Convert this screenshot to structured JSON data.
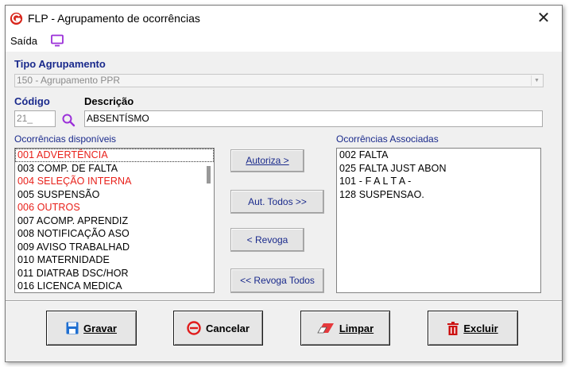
{
  "window": {
    "title": "FLP - Agrupamento de ocorrências",
    "close_symbol": "✕"
  },
  "menu": {
    "saida_label": "Saída"
  },
  "tipo": {
    "label": "Tipo Agrupamento",
    "value": "150 - Agrupamento PPR"
  },
  "codigo": {
    "label": "Código",
    "value": "21_"
  },
  "descricao": {
    "label": "Descrição",
    "value": "ABSENTÍSMO"
  },
  "available": {
    "label": "Ocorrências disponíveis",
    "items": [
      {
        "text": "001 ADVERTÊNCIA",
        "color": "#e8201a"
      },
      {
        "text": "003 COMP. DE FALTA",
        "color": "#000000"
      },
      {
        "text": "004 SELEÇÃO INTERNA",
        "color": "#e8201a"
      },
      {
        "text": "005 SUSPENSÃO",
        "color": "#000000"
      },
      {
        "text": "006 OUTROS",
        "color": "#e8201a"
      },
      {
        "text": "007 ACOMP. APRENDIZ",
        "color": "#000000"
      },
      {
        "text": "008 NOTIFICAÇÃO ASO",
        "color": "#000000"
      },
      {
        "text": "009 AVISO TRABALHAD",
        "color": "#000000"
      },
      {
        "text": "010 MATERNIDADE",
        "color": "#000000"
      },
      {
        "text": "011 DIATRAB DSC/HOR",
        "color": "#000000"
      },
      {
        "text": "016 LICENCA MEDICA",
        "color": "#000000"
      }
    ]
  },
  "associated": {
    "label": "Ocorrências Associadas",
    "items": [
      "002 FALTA",
      "025 FALTA JUST ABON",
      "101 - F A L T A -",
      "128 SUSPENSAO."
    ]
  },
  "mid_buttons": {
    "autoriza": "Autoriza >",
    "aut_todos": "Aut. Todos >>",
    "revoga": "< Revoga",
    "revoga_todos": "<< Revoga Todos"
  },
  "buttons": {
    "gravar": "Gravar",
    "cancelar": "Cancelar",
    "limpar": "Limpar",
    "excluir": "Excluir"
  },
  "colors": {
    "label_blue": "#1a2a8c",
    "red_item": "#e8201a",
    "accent_purple": "#9b30d9"
  }
}
